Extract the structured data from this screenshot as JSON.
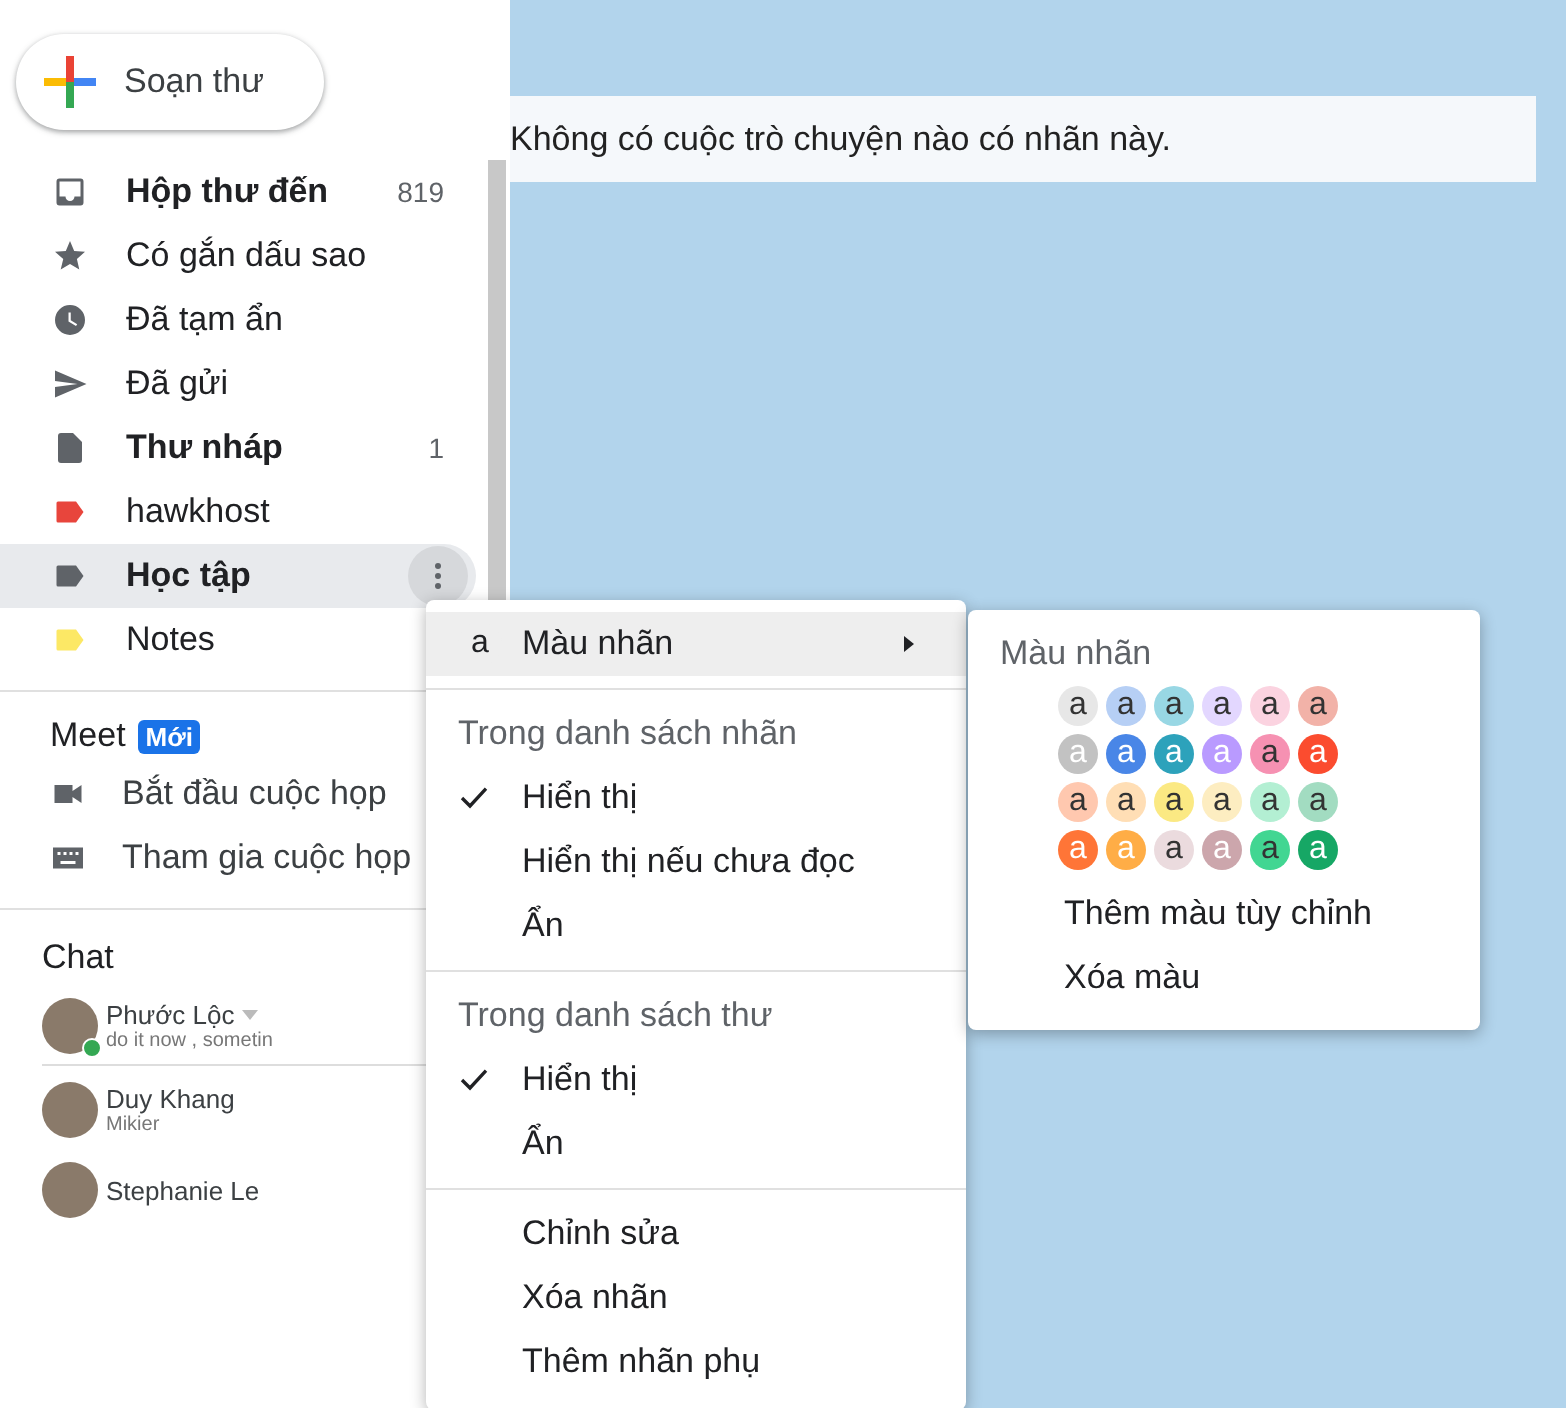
{
  "compose": {
    "label": "Soạn thư"
  },
  "nav": [
    {
      "kind": "inbox",
      "label": "Hộp thư đến",
      "count": "819",
      "bold": true,
      "selected": false
    },
    {
      "kind": "star",
      "label": "Có gắn dấu sao",
      "bold": false,
      "selected": false
    },
    {
      "kind": "clock",
      "label": "Đã tạm ẩn",
      "bold": false,
      "selected": false
    },
    {
      "kind": "send",
      "label": "Đã gửi",
      "bold": false,
      "selected": false
    },
    {
      "kind": "draft",
      "label": "Thư nháp",
      "count": "1",
      "bold": true,
      "selected": false
    },
    {
      "kind": "label",
      "label": "hawkhost",
      "color": "#e8453c",
      "bold": false,
      "selected": false
    },
    {
      "kind": "label",
      "label": "Học tập",
      "color": "#5f6368",
      "bold": true,
      "selected": true
    },
    {
      "kind": "label",
      "label": "Notes",
      "color": "#fce865",
      "bold": false,
      "selected": false
    }
  ],
  "meet": {
    "title": "Meet",
    "badge": "Mới",
    "items": [
      {
        "kind": "video",
        "label": "Bắt đầu cuộc họp"
      },
      {
        "kind": "keyboard",
        "label": "Tham gia cuộc họp"
      }
    ]
  },
  "chat": {
    "title": "Chat",
    "contacts": [
      {
        "name": "Phước Lộc",
        "status": "do it now , sometin",
        "online": true,
        "dropdown": true
      },
      {
        "name": "Duy Khang",
        "status": "Mikier",
        "online": false,
        "dropdown": false
      },
      {
        "name": "Stephanie Le",
        "online": false,
        "dropdown": false
      }
    ]
  },
  "message": "Không có cuộc trò chuyện nào có nhãn này.",
  "menu": {
    "color_item": {
      "icon_letter": "a",
      "label": "Màu nhãn",
      "highlighted": true
    },
    "sections": [
      {
        "title": "Trong danh sách nhãn",
        "items": [
          {
            "label": "Hiển thị",
            "checked": true
          },
          {
            "label": "Hiển thị nếu chưa đọc",
            "checked": false
          },
          {
            "label": "Ẩn",
            "checked": false
          }
        ]
      },
      {
        "title": "Trong danh sách thư",
        "items": [
          {
            "label": "Hiển thị",
            "checked": true
          },
          {
            "label": "Ẩn",
            "checked": false
          }
        ]
      }
    ],
    "actions": [
      "Chỉnh sửa",
      "Xóa nhãn",
      "Thêm nhãn phụ"
    ]
  },
  "submenu": {
    "title": "Màu nhãn",
    "swatches": [
      [
        {
          "color": "#e7e7e7",
          "kind": "dark",
          "letter": "a"
        },
        {
          "color": "#b6cff5",
          "kind": "dark",
          "letter": "a"
        },
        {
          "color": "#98d7e4",
          "kind": "dark",
          "letter": "a"
        },
        {
          "color": "#e3d7ff",
          "kind": "dark",
          "letter": "a"
        },
        {
          "color": "#fbd3e0",
          "kind": "dark",
          "letter": "a"
        },
        {
          "color": "#f2b2a8",
          "kind": "dark",
          "letter": "a"
        }
      ],
      [
        {
          "color": "#c2c2c2",
          "kind": "light",
          "letter": "a"
        },
        {
          "color": "#4986e7",
          "kind": "light",
          "letter": "a"
        },
        {
          "color": "#2da2bb",
          "kind": "light",
          "letter": "a"
        },
        {
          "color": "#b99aff",
          "kind": "light",
          "letter": "a"
        },
        {
          "color": "#f691b2",
          "kind": "dark",
          "letter": "a"
        },
        {
          "color": "#fb4c2f",
          "kind": "light",
          "letter": "a"
        }
      ],
      [
        {
          "color": "#ffc8af",
          "kind": "dark",
          "letter": "a"
        },
        {
          "color": "#ffdeb5",
          "kind": "dark",
          "letter": "a"
        },
        {
          "color": "#fbe983",
          "kind": "dark",
          "letter": "a"
        },
        {
          "color": "#fdedc1",
          "kind": "dark",
          "letter": "a"
        },
        {
          "color": "#b3efd3",
          "kind": "dark",
          "letter": "a"
        },
        {
          "color": "#a2dcc1",
          "kind": "dark",
          "letter": "a"
        }
      ],
      [
        {
          "color": "#ff7537",
          "kind": "light",
          "letter": "a"
        },
        {
          "color": "#ffad46",
          "kind": "light",
          "letter": "a"
        },
        {
          "color": "#ebdbde",
          "kind": "dark",
          "letter": "a"
        },
        {
          "color": "#cca6ac",
          "kind": "light",
          "letter": "a"
        },
        {
          "color": "#42d692",
          "kind": "dark",
          "letter": "a"
        },
        {
          "color": "#16a765",
          "kind": "light",
          "letter": "a"
        }
      ]
    ],
    "actions": [
      "Thêm màu tùy chỉnh",
      "Xóa màu"
    ]
  }
}
